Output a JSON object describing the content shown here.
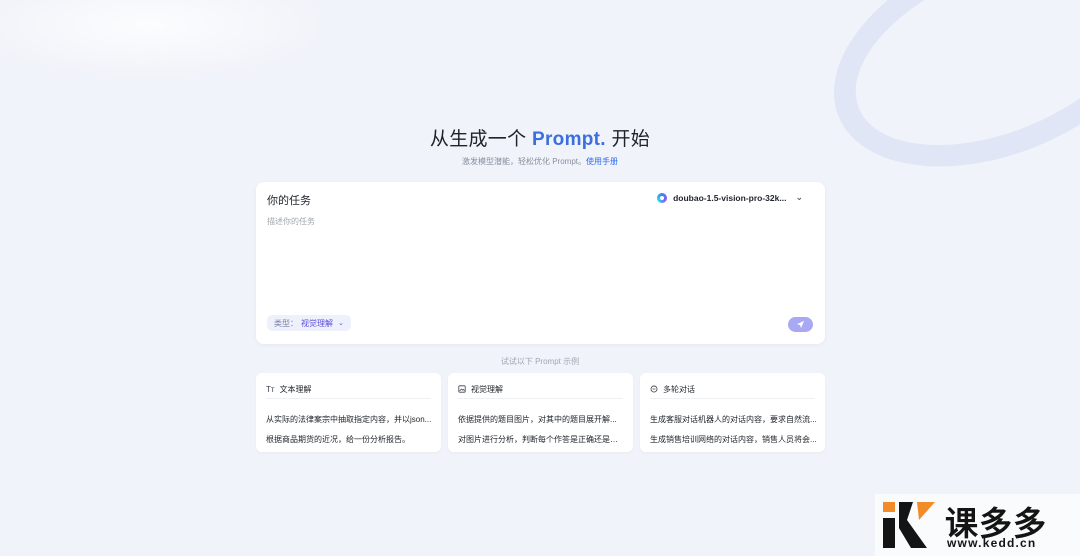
{
  "hero": {
    "title_before": "从生成一个",
    "title_accent": "Prompt.",
    "title_after": "开始",
    "subtitle": "激发模型潜能，轻松优化 Prompt。",
    "manual_link": "使用手册"
  },
  "task": {
    "label": "你的任务",
    "placeholder": "描述你的任务",
    "model": "doubao-1.5-vision-pro-32k...",
    "type_prefix": "类型：",
    "type_value": "视觉理解"
  },
  "examples_hint": "试试以下 Prompt 示例",
  "example_cards": [
    {
      "title": "文本理解",
      "icon": "text-format-icon",
      "items": [
        "从实际的法律案宗中抽取指定内容，并以json...",
        "根据商品期货的近况，给一份分析报告。"
      ]
    },
    {
      "title": "视觉理解",
      "icon": "image-icon",
      "items": [
        "依据提供的题目图片，对其中的题目展开解...",
        "对图片进行分析，判断每个作答是正确还是错误"
      ]
    },
    {
      "title": "多轮对话",
      "icon": "chat-bubble-icon",
      "items": [
        "生成客服对话机器人的对话内容，要求自然流...",
        "生成销售培训网络的对话内容，销售人员将会..."
      ]
    }
  ],
  "watermark": {
    "name": "课多多",
    "url": "www.kedd.cn"
  },
  "colors": {
    "accent": "#3b6fe0",
    "send_button": "#a8a9f2",
    "type_pill_text": "#5b4fd9",
    "background": "#f1f3fa"
  }
}
